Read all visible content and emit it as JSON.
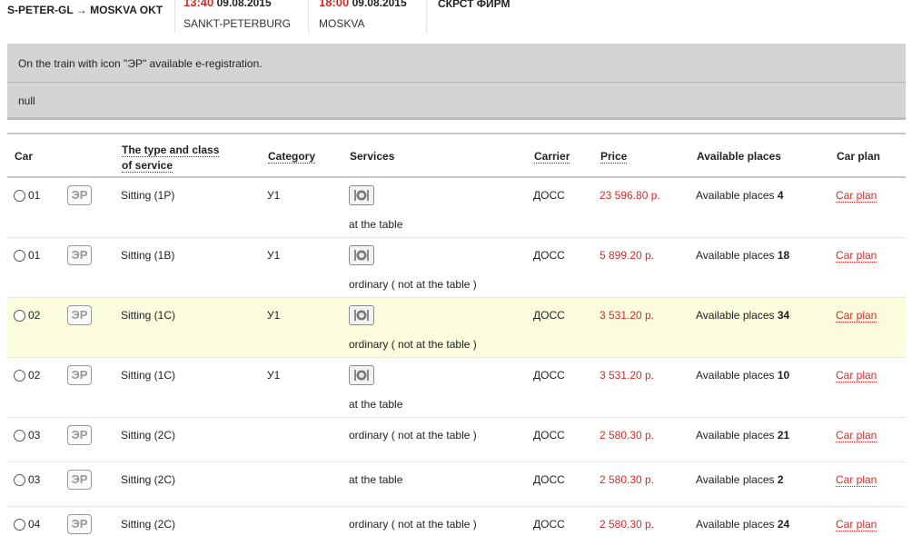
{
  "route": {
    "title": "S-PETER-GL → MOSKVA OKT",
    "departure": {
      "time": "13:40",
      "date": "09.08.2015",
      "station": "SANKT-PETERBURG"
    },
    "arrival": {
      "time": "18:00",
      "date": "09.08.2015",
      "station": "MOSKVA"
    },
    "firm": "СКРСТ ФИРМ"
  },
  "notice": {
    "line1": "On the train with icon \"ЭР\" available e-registration.",
    "line2": "null"
  },
  "table": {
    "headers": {
      "car": "Car",
      "type_line1": "The type and class",
      "type_line2": "of service",
      "category": "Category",
      "services": "Services",
      "carrier": "Carrier",
      "price": "Price",
      "places": "Available places",
      "plan": "Car plan"
    },
    "er_label": "ЭР",
    "places_prefix": "Available places",
    "plan_label": "Car plan",
    "rows": [
      {
        "car": "01",
        "type": "Sitting (1Р)",
        "category": "У1",
        "service_icon": "dining-icon",
        "service": "at the table",
        "carrier": "ДОСС",
        "price": "23 596.80 р.",
        "places": "4",
        "highlight": false
      },
      {
        "car": "01",
        "type": "Sitting (1В)",
        "category": "У1",
        "service_icon": "dining-icon",
        "service": "ordinary ( not at the table )",
        "carrier": "ДОСС",
        "price": "5 899.20 р.",
        "places": "18",
        "highlight": false
      },
      {
        "car": "02",
        "type": "Sitting (1С)",
        "category": "У1",
        "service_icon": "dining-icon",
        "service": "ordinary ( not at the table )",
        "carrier": "ДОСС",
        "price": "3 531.20 р.",
        "places": "34",
        "highlight": true
      },
      {
        "car": "02",
        "type": "Sitting (1С)",
        "category": "У1",
        "service_icon": "dining-icon",
        "service": "at the table",
        "carrier": "ДОСС",
        "price": "3 531.20 р.",
        "places": "10",
        "highlight": false
      },
      {
        "car": "03",
        "type": "Sitting (2С)",
        "category": "",
        "service_icon": "",
        "service": "ordinary ( not at the table )",
        "carrier": "ДОСС",
        "price": "2 580.30 р.",
        "places": "21",
        "highlight": false
      },
      {
        "car": "03",
        "type": "Sitting (2С)",
        "category": "",
        "service_icon": "",
        "service": "at the table",
        "carrier": "ДОСС",
        "price": "2 580.30 р.",
        "places": "2",
        "highlight": false
      },
      {
        "car": "04",
        "type": "Sitting (2С)",
        "category": "",
        "service_icon": "",
        "service": "ordinary ( not at the table )",
        "carrier": "ДОСС",
        "price": "2 580.30 р.",
        "places": "24",
        "highlight": false
      }
    ]
  },
  "colors": {
    "accent": "#d62a2a",
    "highlight_row": "#fbfbdd",
    "notice_bg": "#d4d4d4"
  }
}
